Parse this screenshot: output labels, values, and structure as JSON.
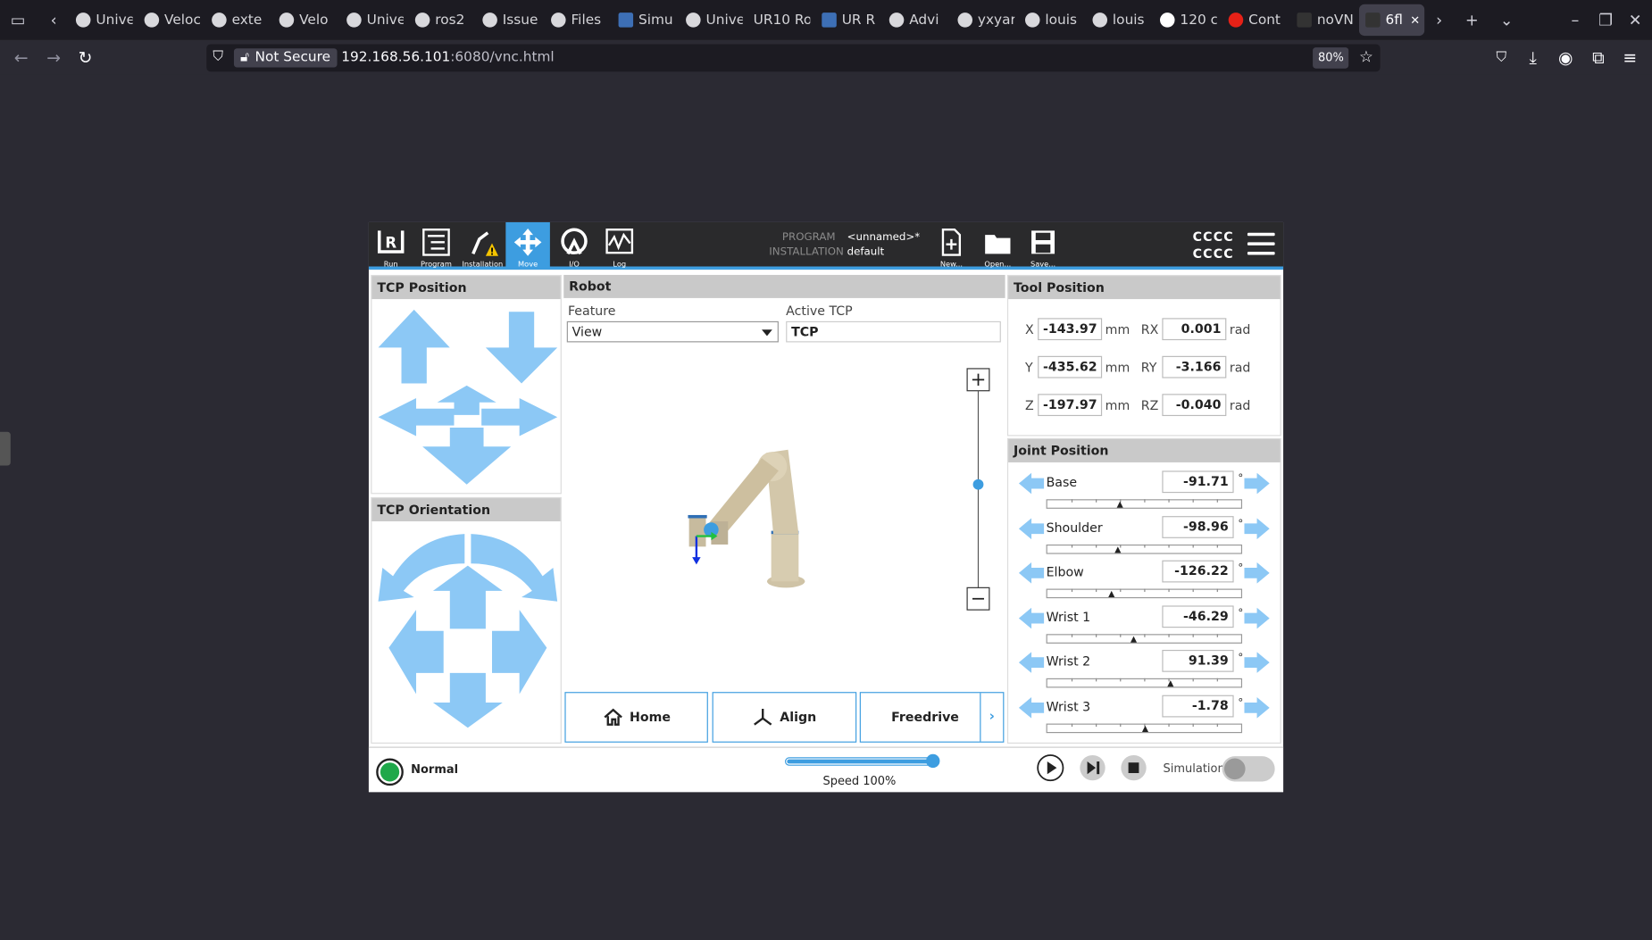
{
  "browser": {
    "tabs": [
      {
        "label": "Unive",
        "icon": "github-icon"
      },
      {
        "label": "Veloc",
        "icon": "github-icon"
      },
      {
        "label": "exte",
        "icon": "github-icon"
      },
      {
        "label": "Velo",
        "icon": "github-icon"
      },
      {
        "label": "Unive",
        "icon": "github-icon"
      },
      {
        "label": "ros2",
        "icon": "github-icon"
      },
      {
        "label": "Issue",
        "icon": "github-icon"
      },
      {
        "label": "Files",
        "icon": "gitlab-icon"
      },
      {
        "label": "Simu",
        "icon": "ur-icon"
      },
      {
        "label": "Unive",
        "icon": "github-icon"
      },
      {
        "label": "UR10 Ro",
        "icon": "none"
      },
      {
        "label": "UR R",
        "icon": "ur-icon"
      },
      {
        "label": "Advi",
        "icon": "github-icon"
      },
      {
        "label": "yxyar",
        "icon": "github-icon"
      },
      {
        "label": "louis",
        "icon": "github-icon"
      },
      {
        "label": "louis",
        "icon": "github-icon"
      },
      {
        "label": "120 c",
        "icon": "google-icon"
      },
      {
        "label": "Cont",
        "icon": "youtube-icon"
      },
      {
        "label": "noVN",
        "icon": "vnc-icon"
      },
      {
        "label": "6fl",
        "icon": "vnc-icon",
        "active": true
      }
    ],
    "security": "Not Secure",
    "url_host": "192.168.56.101",
    "url_rest": ":6080/vnc.html",
    "zoom": "80%"
  },
  "polyscope": {
    "nav": [
      {
        "label": "Run"
      },
      {
        "label": "Program"
      },
      {
        "label": "Installation"
      },
      {
        "label": "Move",
        "selected": true
      },
      {
        "label": "I/O"
      },
      {
        "label": "Log"
      }
    ],
    "program_label": "PROGRAM",
    "program_value": "<unnamed>*",
    "installation_label": "INSTALLATION",
    "installation_value": "default",
    "file_buttons": [
      "New...",
      "Open...",
      "Save..."
    ],
    "user_line1": "CCCC",
    "user_line2": "CCCC",
    "tcp_position_title": "TCP Position",
    "tcp_orientation_title": "TCP Orientation",
    "robot_title": "Robot",
    "feature_label": "Feature",
    "feature_value": "View",
    "active_tcp_label": "Active TCP",
    "active_tcp_value": "TCP",
    "tool_position_title": "Tool Position",
    "tool_position": {
      "x": "-143.97",
      "y": "-435.62",
      "z": "-197.97",
      "rx": "0.001",
      "ry": "-3.166",
      "rz": "-0.040",
      "labels": {
        "x": "X",
        "y": "Y",
        "z": "Z",
        "rx": "RX",
        "ry": "RY",
        "rz": "RZ"
      },
      "unit_mm": "mm",
      "unit_rad": "rad"
    },
    "joint_position_title": "Joint Position",
    "joints": [
      {
        "name": "Base",
        "value": "-91.71",
        "fraction": 0.37
      },
      {
        "name": "Shoulder",
        "value": "-98.96",
        "fraction": 0.36
      },
      {
        "name": "Elbow",
        "value": "-126.22",
        "fraction": 0.33
      },
      {
        "name": "Wrist 1",
        "value": "-46.29",
        "fraction": 0.44
      },
      {
        "name": "Wrist 2",
        "value": "91.39",
        "fraction": 0.63
      },
      {
        "name": "Wrist 3",
        "value": "-1.78",
        "fraction": 0.5
      }
    ],
    "deg": "°",
    "buttons": {
      "home": "Home",
      "align": "Align",
      "freedrive": "Freedrive"
    },
    "status": "Normal",
    "speed_label": "Speed 100%",
    "speed_fraction": 1.0,
    "simulation_label": "Simulation",
    "colors": {
      "accent": "#3d9de0",
      "arrow": "#8cc8f5",
      "status_ok": "#1fa84a",
      "header": "#2a2a2c"
    }
  }
}
